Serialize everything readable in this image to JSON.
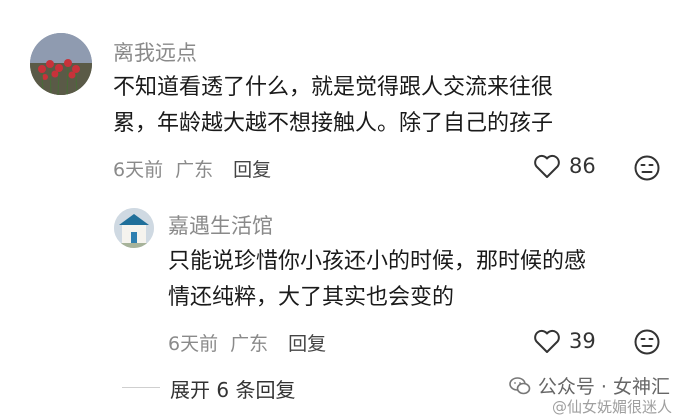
{
  "comment": {
    "username": "离我远点",
    "line1": "不知道看透了什么，就是觉得跟人交流来往很",
    "line2": "累，年龄越大越不想接触人。除了自己的孩子",
    "time": "6天前",
    "location": "广东",
    "reply_label": "回复",
    "like_count": "86"
  },
  "reply": {
    "username": "嘉遇生活馆",
    "line1": "只能说珍惜你小孩还小的时候，那时候的感",
    "line2": "情还纯粹，大了其实也会变的",
    "time": "6天前",
    "location": "广东",
    "reply_label": "回复",
    "like_count": "39"
  },
  "expand_label": "展开 6 条回复",
  "watermark": {
    "text": "公众号 · 女神汇",
    "sub": "@仙女妩媚很迷人"
  },
  "colors": {
    "meta_gray": "#8a8a8a",
    "text": "#1a1a1a"
  }
}
